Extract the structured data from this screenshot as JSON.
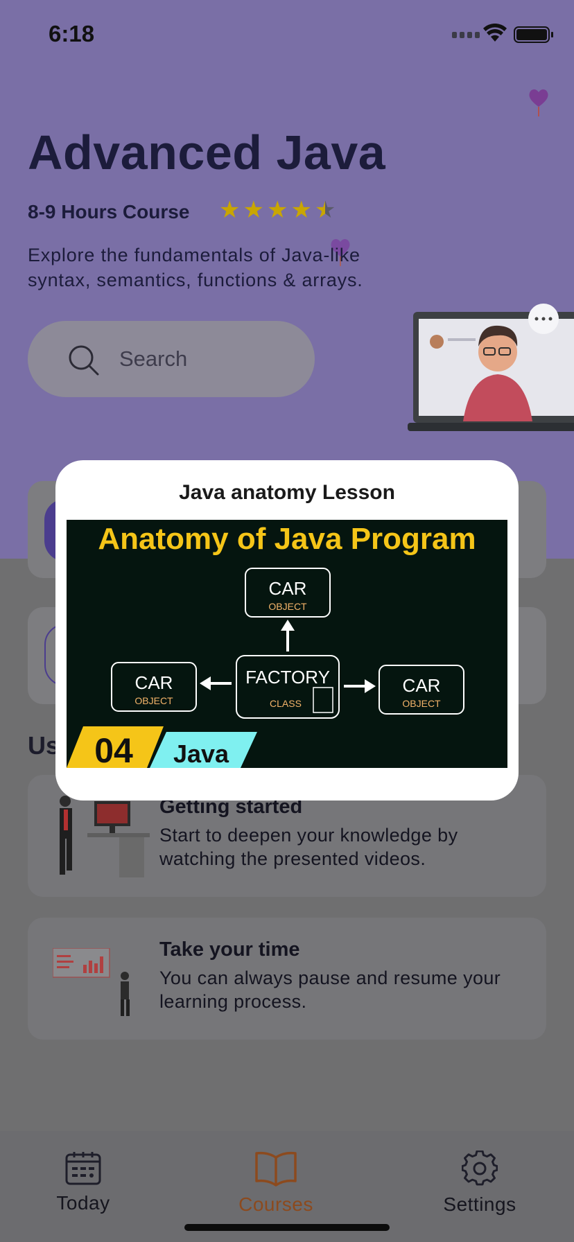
{
  "status_bar": {
    "time": "6:18"
  },
  "course": {
    "title": "Advanced Java",
    "duration": "8-9 Hours Course",
    "rating": 4.5,
    "description": "Explore the fundamentals of Java-like syntax, semantics, functions & arrays."
  },
  "search": {
    "placeholder": "Search"
  },
  "section": {
    "title": "Us"
  },
  "info_cards": [
    {
      "title": "Getting started",
      "text": "Start to deepen your knowledge by watching the presented videos.",
      "icon": "desk-person-illustration"
    },
    {
      "title": "Take your time",
      "text": "You can always pause and resume your learning process.",
      "icon": "presentation-person-illustration"
    }
  ],
  "modal": {
    "title": "Java anatomy Lesson",
    "image": {
      "headline": "Anatomy of Java Program",
      "nodes": {
        "top": {
          "label": "CAR",
          "sub": "OBJECT"
        },
        "left": {
          "label": "CAR",
          "sub": "OBJECT"
        },
        "center": {
          "label": "FACTORY",
          "sub": "CLASS"
        },
        "right": {
          "label": "CAR",
          "sub": "OBJECT"
        }
      },
      "episode": "04",
      "tag": "Java"
    }
  },
  "tabbar": {
    "items": [
      {
        "label": "Today",
        "icon": "calendar-icon"
      },
      {
        "label": "Courses",
        "icon": "book-icon",
        "active": true
      },
      {
        "label": "Settings",
        "icon": "gear-icon"
      }
    ]
  },
  "colors": {
    "accent": "#8c4a1e",
    "hero": "#7a6fa6",
    "star": "#c9a600",
    "thumbnail_yellow": "#f5c518",
    "thumbnail_cyan": "#7ff0f0"
  }
}
